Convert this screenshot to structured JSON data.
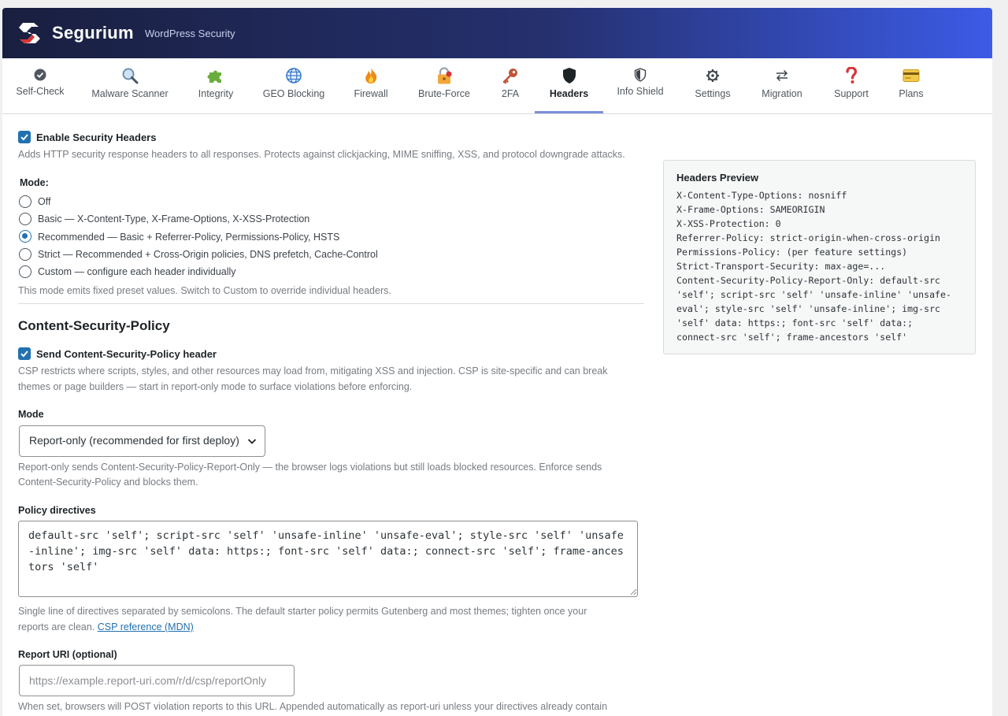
{
  "app": {
    "brand": "Segurium",
    "tagline": "WordPress Security"
  },
  "colors": {
    "header_start": "#191f3f",
    "header_end": "#3c5be6",
    "accent": "#2271b1",
    "active_tab_underline": "#7b8fd9"
  },
  "tabs": [
    {
      "label": "Self-Check",
      "icon": "check-circle-icon"
    },
    {
      "label": "Malware Scanner",
      "icon": "magnifier-icon"
    },
    {
      "label": "Integrity",
      "icon": "puzzle-icon"
    },
    {
      "label": "GEO Blocking",
      "icon": "globe-icon"
    },
    {
      "label": "Firewall",
      "icon": "fire-icon"
    },
    {
      "label": "Brute-Force",
      "icon": "lock-icon"
    },
    {
      "label": "2FA",
      "icon": "key-icon"
    },
    {
      "label": "Headers",
      "icon": "shield-icon",
      "active": true
    },
    {
      "label": "Info Shield",
      "icon": "shield-check-icon"
    },
    {
      "label": "Settings",
      "icon": "gear-icon"
    },
    {
      "label": "Migration",
      "icon": "arrows-icon"
    },
    {
      "label": "Support",
      "icon": "question-icon"
    },
    {
      "label": "Plans",
      "icon": "credit-card-icon"
    }
  ],
  "security_headers": {
    "enable_label": "Enable Security Headers",
    "enabled": true,
    "enable_desc": "Adds HTTP security response headers to all responses. Protects against clickjacking, MIME sniffing, XSS, and protocol downgrade attacks.",
    "mode_label": "Mode:",
    "modes": [
      {
        "label": "Off",
        "selected": false
      },
      {
        "label": "Basic — X-Content-Type, X-Frame-Options, X-XSS-Protection",
        "selected": false
      },
      {
        "label": "Recommended — Basic + Referrer-Policy, Permissions-Policy, HSTS",
        "selected": true
      },
      {
        "label": "Strict — Recommended + Cross-Origin policies, DNS prefetch, Cache-Control",
        "selected": false
      },
      {
        "label": "Custom — configure each header individually",
        "selected": false
      }
    ],
    "mode_note": "This mode emits fixed preset values. Switch to Custom to override individual headers."
  },
  "csp": {
    "title": "Content-Security-Policy",
    "send_label": "Send Content-Security-Policy header",
    "send_enabled": true,
    "desc_line1": "CSP restricts where scripts, styles, and other resources may load from, mitigating XSS and injection. CSP is site-specific and can break",
    "desc_line2": "themes or page builders — start in report-only mode to surface violations before enforcing.",
    "mode_label": "Mode",
    "mode_value": "Report-only (recommended for first deploy)",
    "mode_desc_line1": "Report-only sends Content-Security-Policy-Report-Only — the browser logs violations but still loads blocked resources. Enforce sends",
    "mode_desc_line2": "Content-Security-Policy and blocks them.",
    "directives_label": "Policy directives",
    "directives_value": "default-src 'self'; script-src 'self' 'unsafe-inline' 'unsafe-eval'; style-src 'self' 'unsafe-inline'; img-src 'self' data: https:; font-src 'self' data:; connect-src 'self'; frame-ancestors 'self'",
    "directives_desc_line1": "Single line of directives separated by semicolons. The default starter policy permits Gutenberg and most themes; tighten once your",
    "directives_desc_line2": "reports are clean.",
    "reference_link": "CSP reference (MDN)",
    "report_uri_label": "Report URI (optional)",
    "report_uri_placeholder": "https://example.report-uri.com/r/d/csp/reportOnly",
    "report_uri_desc": "When set, browsers will POST violation reports to this URL. Appended automatically as report-uri unless your directives already contain"
  },
  "preview": {
    "title": "Headers Preview",
    "lines": [
      "X-Content-Type-Options: nosniff",
      "X-Frame-Options: SAMEORIGIN",
      "X-XSS-Protection: 0",
      "Referrer-Policy: strict-origin-when-cross-origin",
      "Permissions-Policy: (per feature settings)",
      "Strict-Transport-Security: max-age=...",
      "Content-Security-Policy-Report-Only: default-src",
      "'self'; script-src 'self' 'unsafe-inline' 'unsafe-",
      "eval'; style-src 'self' 'unsafe-inline'; img-src",
      "'self' data: https:; font-src 'self' data:;",
      "connect-src 'self'; frame-ancestors 'self'"
    ]
  }
}
